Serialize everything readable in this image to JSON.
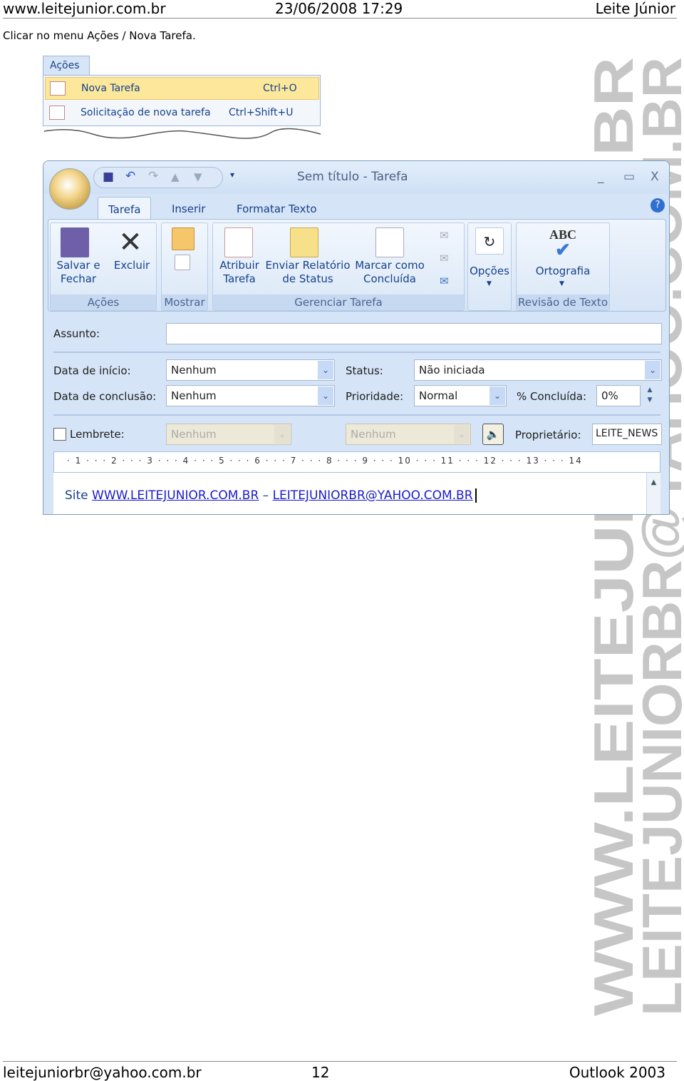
{
  "header": {
    "site": "www.leitejunior.com.br",
    "datetime": "23/06/2008 17:29",
    "author": "Leite Júnior"
  },
  "instruction": "Clicar no menu Ações / Nova Tarefa.",
  "menu": {
    "title": "Ações",
    "items": [
      {
        "label": "Nova Tarefa",
        "shortcut": "Ctrl+O",
        "selected": true
      },
      {
        "label": "Solicitação de nova tarefa",
        "shortcut": "Ctrl+Shift+U",
        "selected": false
      }
    ]
  },
  "window": {
    "title": "Sem título - Tarefa",
    "minimize": "_",
    "maximize": "▭",
    "close": "X",
    "help": "?"
  },
  "tabs": [
    "Tarefa",
    "Inserir",
    "Formatar Texto"
  ],
  "ribbon": {
    "groups": [
      "Ações",
      "Mostrar",
      "Gerenciar Tarefa",
      "Revisão de Texto"
    ],
    "buttons": {
      "save_close": [
        "Salvar e",
        "Fechar"
      ],
      "delete": "Excluir",
      "assign": [
        "Atribuir",
        "Tarefa"
      ],
      "status_report": [
        "Enviar Relatório",
        "de Status"
      ],
      "mark_complete": [
        "Marcar como",
        "Concluída"
      ],
      "options": "Opções",
      "spelling": "Ortografia",
      "spelling_icon_text": "ABC"
    }
  },
  "form": {
    "subject_label": "Assunto:",
    "subject_value": "",
    "start_label": "Data de início:",
    "start_value": "Nenhum",
    "due_label": "Data de conclusão:",
    "due_value": "Nenhum",
    "status_label": "Status:",
    "status_value": "Não iniciada",
    "priority_label": "Prioridade:",
    "priority_value": "Normal",
    "percent_label": "% Concluída:",
    "percent_value": "0%",
    "reminder_label": "Lembrete:",
    "reminder_checked": false,
    "reminder_date": "Nenhum",
    "reminder_time": "Nenhum",
    "owner_label": "Proprietário:",
    "owner_value": "LEITE_NEWS"
  },
  "ruler": "· 1 · · · 2 · · · 3 · · · 4 · · · 5 · · · 6 · · · 7 · · · 8 · · · 9 · · · 10 · · · 11 · · · 12 · · · 13 · · · 14",
  "body": {
    "prefix": "Site ",
    "link1": "WWW.LEITEJUNIOR.COM.BR",
    "dash": " – ",
    "link2": "LEITEJUNIORBR@YAHOO.COM.BR"
  },
  "watermark": [
    "WWW.LEITEJUNIOR.COM.BR",
    "LEITEJUNIORBR@YAHOO.COM.BR"
  ],
  "footer": {
    "email": "leitejuniorbr@yahoo.com.br",
    "page": "12",
    "doc": "Outlook 2003"
  }
}
